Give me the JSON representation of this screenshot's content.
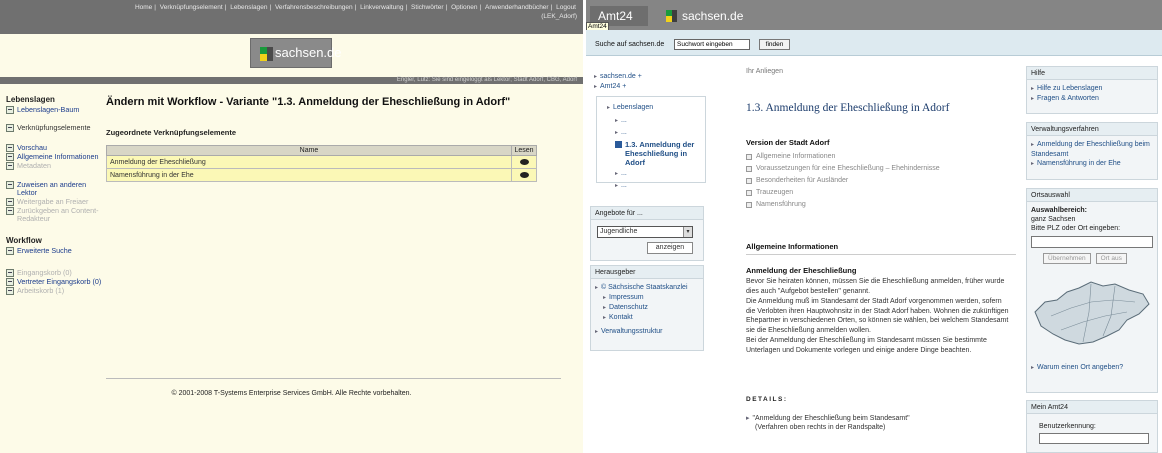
{
  "left": {
    "topnav": [
      "Home",
      "|",
      "Verknüpfungselement",
      "|",
      "Lebenslagen",
      "|",
      "Verfahrensbeschreibungen",
      "|",
      "Linkverwaltung",
      "|",
      "Stichwörter",
      "|",
      "Optionen",
      "|",
      "Anwenderhandbücher",
      "|",
      "Logout"
    ],
    "topnav_user": "(LEK_Adorf)",
    "logo_text": "sachsen.de",
    "userbar": "Engler, Lutz: Sie sind eingeloggt als Lektor; Stadt Adorf, CBG, Adorf",
    "nav": {
      "h1": "Lebenslagen",
      "i1": "Lebenslagen-Baum",
      "i2": "Verknüpfungselemente",
      "i3": "Vorschau",
      "i4": "Allgemeine Informationen",
      "i5": "Metadaten",
      "i6": "Zuweisen an anderen Lektor",
      "i7": "Weitergabe an Freiaer",
      "i8": "Zurückgeben an Content-Redakteur",
      "h2": "Workflow",
      "i9": "Erweiterte Suche",
      "i10": "Eingangskorb (0)",
      "i11": "Vertreter Eingangskorb (0)",
      "i12": "Arbeitskorb (1)"
    },
    "title": "Ändern mit Workflow - Variante \"1.3. Anmeldung der Eheschließung in Adorf\"",
    "subtitle": "Zugeordnete Verknüpfungselemente",
    "table": {
      "col_name": "Name",
      "col_read": "Lesen",
      "rows": [
        "Anmeldung der Eheschließung",
        "Namensführung in der Ehe"
      ]
    },
    "copyright": "© 2001-2008 T-Systems Enterprise Services GmbH. Alle Rechte vorbehalten."
  },
  "right": {
    "amt": "Amt24",
    "amt_tooltip": "Amt24",
    "logo_text": "sachsen.de",
    "search_label": "Suche auf sachsen.de",
    "search_placeholder": "Suchwort eingeben",
    "search_button": "finden",
    "crumb1": "sachsen.de +",
    "crumb2": "Amt24 +",
    "nav_lebenslagen": "Lebenslagen",
    "nav_dots1": "...",
    "nav_dots2": "...",
    "nav_current": "1.3. Anmeldung der Eheschließung in Adorf",
    "nav_dots3": "...",
    "nav_dots4": "...",
    "angebote_title": "Angebote für ...",
    "angebote_select": "Jugendliche",
    "angebote_button": "anzeigen",
    "herausgeber_title": "Herausgeber",
    "hg1": "© Sächsische Staatskanzlei",
    "hg2": "Impressum",
    "hg3": "Datenschutz",
    "hg4": "Kontakt",
    "hg5": "Verwaltungsstruktur",
    "anliegen": "Ihr Anliegen",
    "title": "1.3. Anmeldung der Eheschließung in Adorf",
    "version": "Version der Stadt Adorf",
    "list": [
      "Allgemeine Informationen",
      "Voraussetzungen für eine Eheschließung – Ehehindernisse",
      "Besonderheiten für Ausländer",
      "Trauzeugen",
      "Namensführung"
    ],
    "allg_title": "Allgemeine Informationen",
    "anm_title": "Anmeldung der Eheschließung",
    "p1": "Bevor Sie heiraten können, müssen Sie die Eheschließung anmelden, früher wurde dies auch \"Aufgebot bestellen\" genannt.",
    "p2": "Die Anmeldung muß im Standesamt der Stadt Adorf vorgenommen werden, sofern die Verlobten ihren Hauptwohnsitz in der Stadt Adorf haben. Wohnen die zukünftigen Ehepartner in verschiedenen Orten, so können sie wählen, bei welchem Standesamt sie die Eheschließung anmelden wollen.",
    "p3": "Bei der Anmeldung der Eheschließung im Standesamt müssen Sie bestimmte Unterlagen und Dokumente vorlegen und einige andere Dinge beachten.",
    "details": "DETAILS:",
    "details_link": "\"Anmeldung der Eheschließung beim Standesamt\"",
    "details_note": "(Verfahren oben rechts in der Randspalte)",
    "hilfe_title": "Hilfe",
    "hilfe1": "Hilfe zu Lebenslagen",
    "hilfe2": "Fragen & Antworten",
    "vv_title": "Verwaltungsverfahren",
    "vv1": "Anmeldung der Eheschließung beim Standesamt",
    "vv2": "Namensführung in der Ehe",
    "ort_title": "Ortsauswahl",
    "ort_label": "Auswahlbereich:",
    "ort_value": "ganz Sachsen",
    "ort_prompt": "Bitte PLZ oder Ort eingeben:",
    "ort_btn1": "Übernehmen",
    "ort_btn2": "Ort aus",
    "ort_why": "Warum einen Ort angeben?",
    "mein_title": "Mein Amt24",
    "benutzer": "Benutzerkennung:"
  }
}
